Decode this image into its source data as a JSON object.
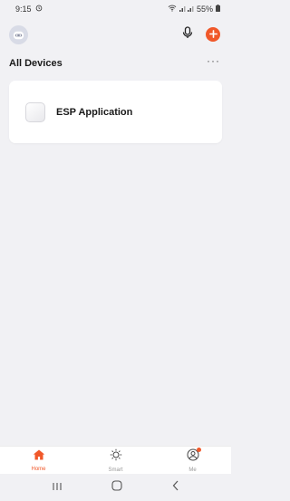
{
  "status_bar": {
    "time": "9:15",
    "battery": "55%"
  },
  "header": {
    "avatar_icon": "avatar-icon",
    "mic_icon": "microphone-icon",
    "add_icon": "plus-icon"
  },
  "section": {
    "title": "All Devices",
    "more_label": "···"
  },
  "devices": [
    {
      "name": "ESP Application"
    }
  ],
  "tabs": [
    {
      "label": "Home",
      "icon": "home-icon",
      "active": true
    },
    {
      "label": "Smart",
      "icon": "sun-icon",
      "active": false
    },
    {
      "label": "Me",
      "icon": "profile-icon",
      "active": false
    }
  ],
  "colors": {
    "accent": "#f0582a",
    "background": "#f1f1f4"
  }
}
